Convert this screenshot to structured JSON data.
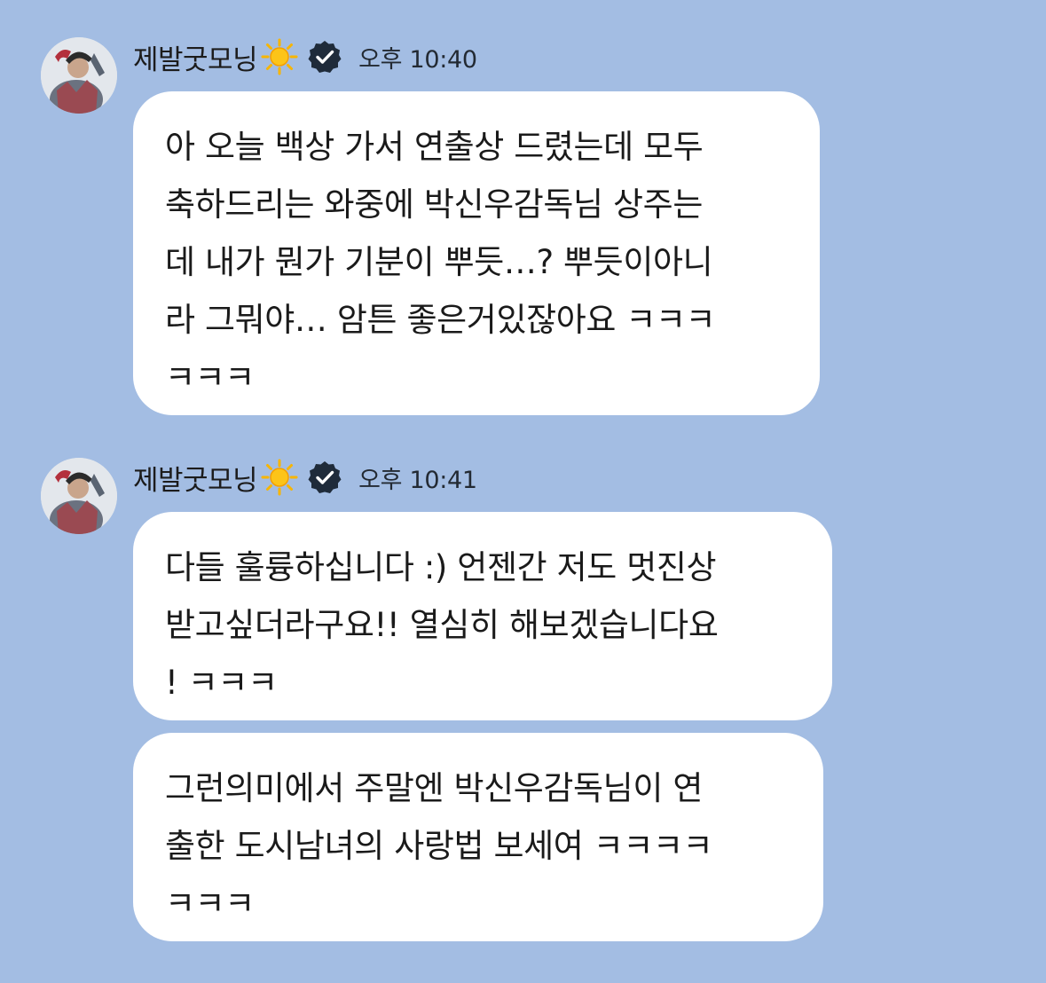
{
  "messages": [
    {
      "sender": "제발굿모닝",
      "time": "오후 10:40",
      "bubbles": [
        "아 오늘 백상 가서 연출상 드렸는데 모두\n축하드리는 와중에 박신우감독님 상주는\n데 내가 뭔가 기분이 뿌듯…? 뿌듯이아니\n라 그뭐야… 암튼 좋은거있잖아요 ㅋㅋㅋ\nㅋㅋㅋ"
      ]
    },
    {
      "sender": "제발굿모닝",
      "time": "오후 10:41",
      "bubbles": [
        "다들 훌륭하십니다 :) 언젠간 저도 멋진상\n받고싶더라구요!! 열심히 해보겠습니다요\n! ㅋㅋㅋ",
        "그런의미에서 주말엔 박신우감독님이 연\n출한 도시남녀의 사랑법 보세여 ㅋㅋㅋㅋ\nㅋㅋㅋ"
      ]
    }
  ],
  "colors": {
    "background": "#a3bde3",
    "bubble": "#ffffff",
    "sun": "#f7b500",
    "verified_badge": "#1f2b3a"
  },
  "icons": {
    "sun": "sun-emoji-icon",
    "verified": "verified-badge-icon"
  }
}
